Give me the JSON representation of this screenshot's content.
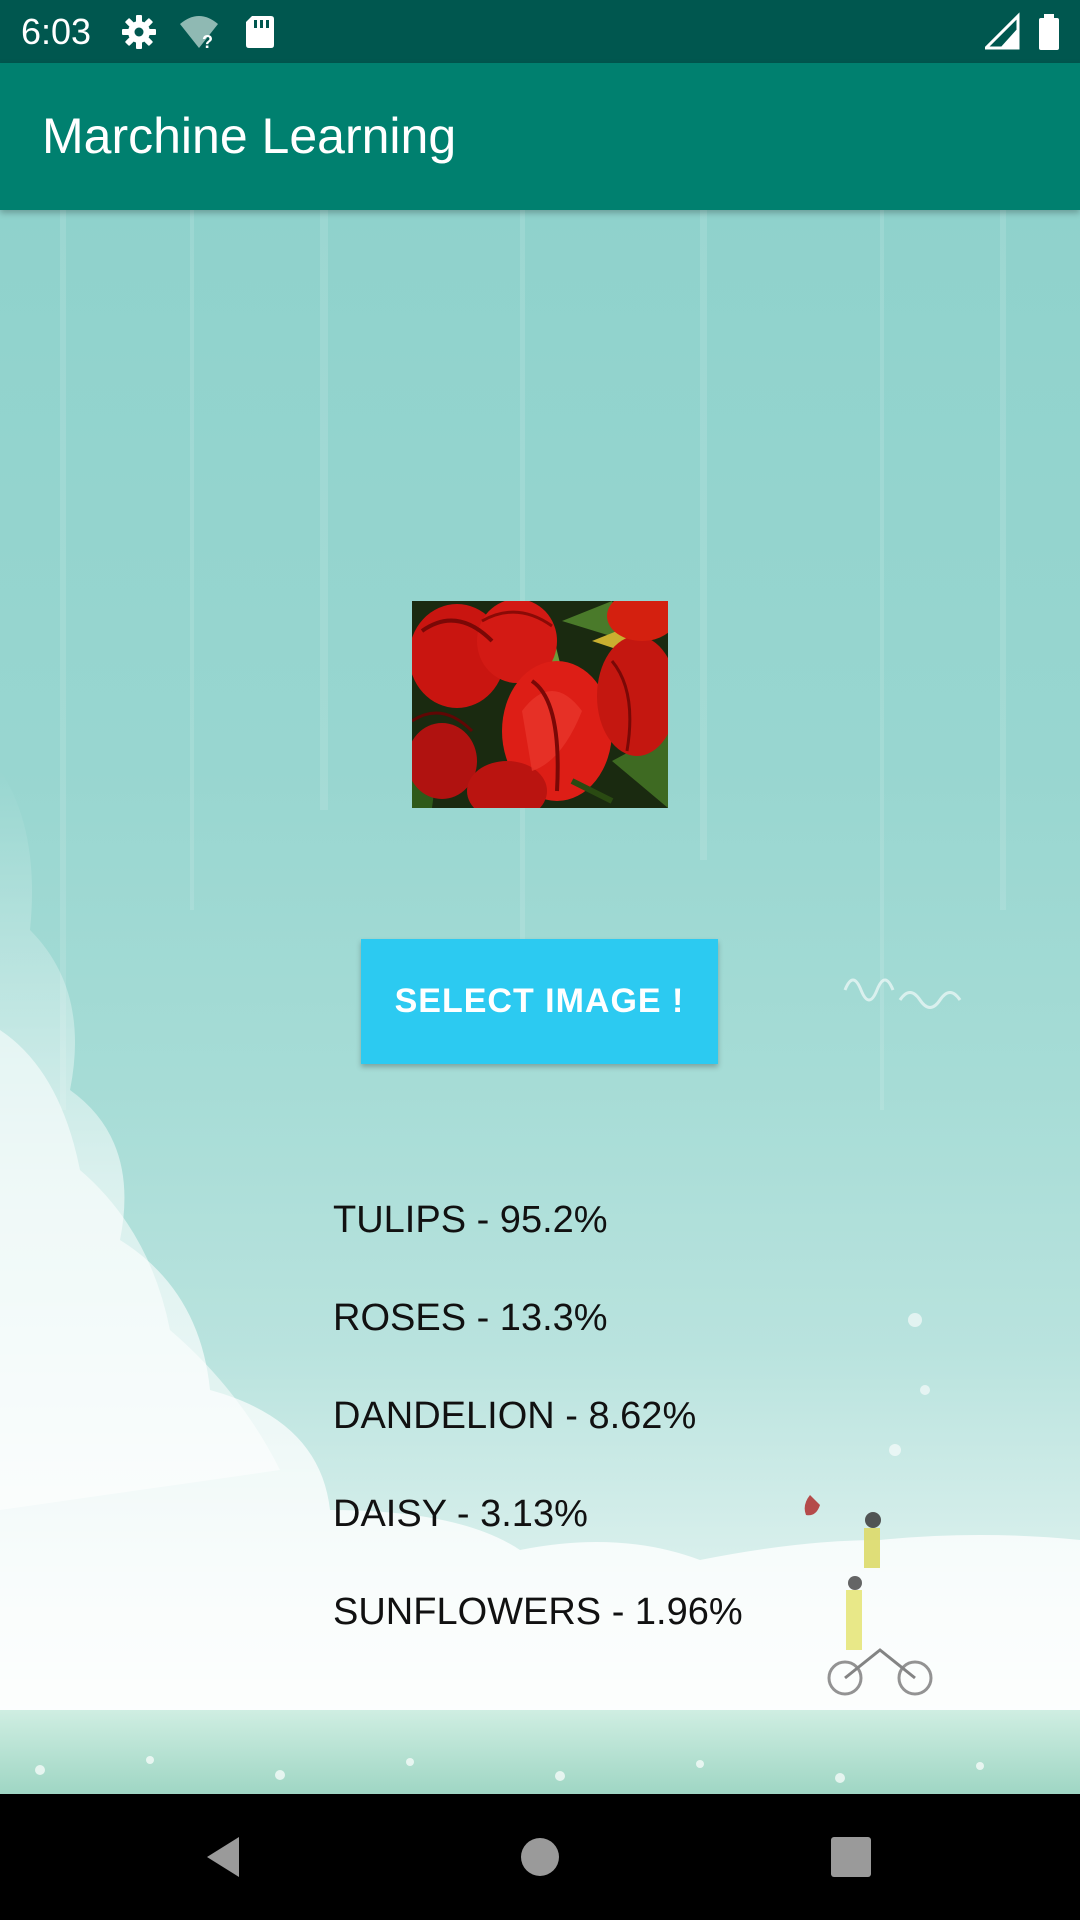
{
  "status_bar": {
    "time": "6:03",
    "icons_left": [
      "settings-gear-icon",
      "wifi-unknown-icon",
      "sd-card-icon"
    ],
    "icons_right": [
      "cell-signal-icon",
      "battery-icon"
    ],
    "background": "#00574f"
  },
  "app_bar": {
    "title": "Marchine Learning",
    "background": "#00806f"
  },
  "selected_image": {
    "description_icon": "red-tulips-photo"
  },
  "select_button": {
    "label": "SELECT IMAGE !",
    "background": "#2ccaf1"
  },
  "results": [
    {
      "label": "TULIPS - 95.2%"
    },
    {
      "label": "ROSES - 13.3%"
    },
    {
      "label": "DANDELION - 8.62%"
    },
    {
      "label": "DAISY - 3.13%"
    },
    {
      "label": "SUNFLOWERS - 1.96%"
    }
  ],
  "nav_bar": {
    "buttons": [
      "back-icon",
      "home-icon",
      "recents-icon"
    ]
  }
}
